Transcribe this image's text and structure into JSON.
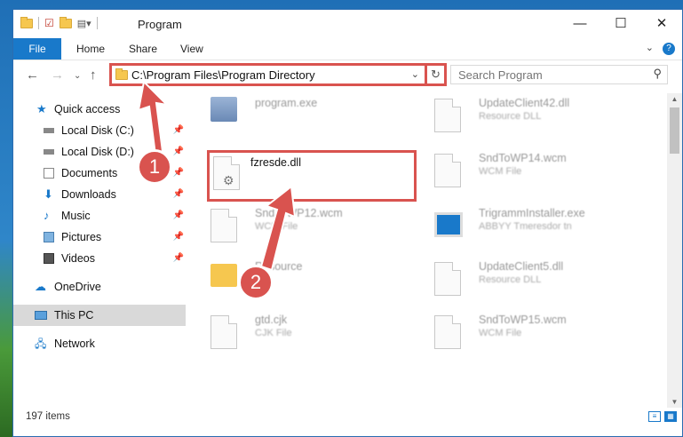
{
  "window": {
    "title": "Program",
    "controls": {
      "minimize": "—",
      "maximize": "☐",
      "close": "✕"
    }
  },
  "ribbon": {
    "tabs": [
      "File",
      "Home",
      "Share",
      "View"
    ],
    "help": "?"
  },
  "address": {
    "path": "C:\\Program Files\\Program Directory"
  },
  "search": {
    "placeholder": "Search Program"
  },
  "sidebar": {
    "items": [
      {
        "label": "Quick access",
        "icon": "star-icon"
      },
      {
        "label": "Local Disk (C:)",
        "icon": "drive-icon",
        "pinned": true
      },
      {
        "label": "Local Disk (D:)",
        "icon": "drive-icon",
        "pinned": true
      },
      {
        "label": "Documents",
        "icon": "documents-icon",
        "pinned": true
      },
      {
        "label": "Downloads",
        "icon": "download-icon",
        "pinned": true
      },
      {
        "label": "Music",
        "icon": "music-icon",
        "pinned": true
      },
      {
        "label": "Pictures",
        "icon": "pictures-icon",
        "pinned": true
      },
      {
        "label": "Videos",
        "icon": "videos-icon",
        "pinned": true
      },
      {
        "label": "OneDrive",
        "icon": "cloud-icon"
      },
      {
        "label": "This PC",
        "icon": "computer-icon",
        "selected": true
      },
      {
        "label": "Network",
        "icon": "network-icon"
      }
    ]
  },
  "files": [
    {
      "name": "program.exe",
      "type": ""
    },
    {
      "name": "UpdateClient42.dll",
      "type": "Resource DLL"
    },
    {
      "name": "fzresde.dll",
      "type": "",
      "highlighted": true
    },
    {
      "name": "SndToWP14.wcm",
      "type": "WCM File"
    },
    {
      "name": "SndToWP12.wcm",
      "type": "WCM File"
    },
    {
      "name": "TrigrammInstaller.exe",
      "type": "ABBYY Tmeresdor tn"
    },
    {
      "name": "Resource",
      "type": ""
    },
    {
      "name": "UpdateClient5.dll",
      "type": "Resource DLL"
    },
    {
      "name": "gtd.cjk",
      "type": "CJK File"
    },
    {
      "name": "SndToWP15.wcm",
      "type": "WCM File"
    }
  ],
  "status": {
    "item_count": "197 items"
  },
  "annotations": {
    "badge1": "1",
    "badge2": "2",
    "color": "#d9534f"
  }
}
